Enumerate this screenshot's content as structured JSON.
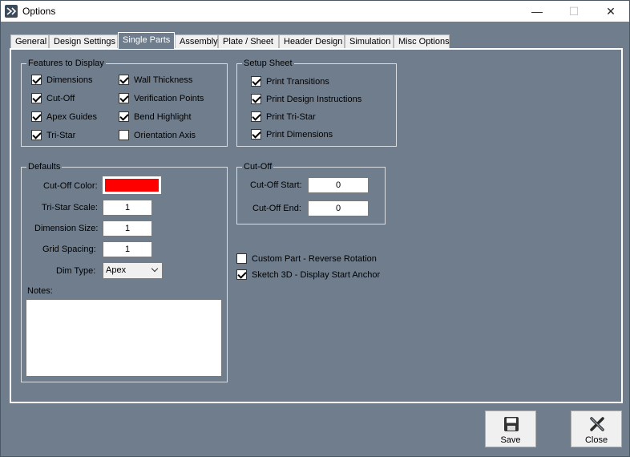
{
  "window": {
    "title": "Options"
  },
  "tabs": [
    {
      "label": "General"
    },
    {
      "label": "Design Settings"
    },
    {
      "label": "Single Parts"
    },
    {
      "label": "Assembly"
    },
    {
      "label": "Plate / Sheet"
    },
    {
      "label": "Header Design"
    },
    {
      "label": "Simulation"
    },
    {
      "label": "Misc Options"
    }
  ],
  "active_tab": "Single Parts",
  "features": {
    "title": "Features to Display",
    "items": [
      {
        "label": "Dimensions",
        "checked": true
      },
      {
        "label": "Cut-Off",
        "checked": true
      },
      {
        "label": "Apex Guides",
        "checked": true
      },
      {
        "label": "Tri-Star",
        "checked": true
      },
      {
        "label": "Wall Thickness",
        "checked": true
      },
      {
        "label": "Verification Points",
        "checked": true
      },
      {
        "label": "Bend Highlight",
        "checked": true
      },
      {
        "label": "Orientation Axis",
        "checked": false
      }
    ]
  },
  "setup_sheet": {
    "title": "Setup Sheet",
    "items": [
      {
        "label": "Print Transitions",
        "checked": true
      },
      {
        "label": "Print Design Instructions",
        "checked": true
      },
      {
        "label": "Print Tri-Star",
        "checked": true
      },
      {
        "label": "Print Dimensions",
        "checked": true
      }
    ]
  },
  "defaults": {
    "title": "Defaults",
    "cutoff_color_label": "Cut-Off Color:",
    "cutoff_color": "#ff0000",
    "tristar_scale_label": "Tri-Star Scale:",
    "tristar_scale": "1",
    "dimension_size_label": "Dimension Size:",
    "dimension_size": "1",
    "grid_spacing_label": "Grid Spacing:",
    "grid_spacing": "1",
    "dim_type_label": "Dim Type:",
    "dim_type": "Apex",
    "notes_label": "Notes:",
    "notes": ""
  },
  "cutoff": {
    "title": "Cut-Off",
    "start_label": "Cut-Off Start:",
    "start": "0",
    "end_label": "Cut-Off End:",
    "end": "0"
  },
  "options": [
    {
      "label": "Custom Part - Reverse Rotation",
      "checked": false
    },
    {
      "label": "Sketch 3D - Display Start Anchor",
      "checked": true
    }
  ],
  "buttons": {
    "save": "Save",
    "close": "Close"
  },
  "icons": {
    "app": "app-logo-icon",
    "save": "floppy-disk-icon",
    "close": "close-x-icon"
  },
  "colors": {
    "panel": "#6f7d8d",
    "accent_red": "#ff0000"
  }
}
